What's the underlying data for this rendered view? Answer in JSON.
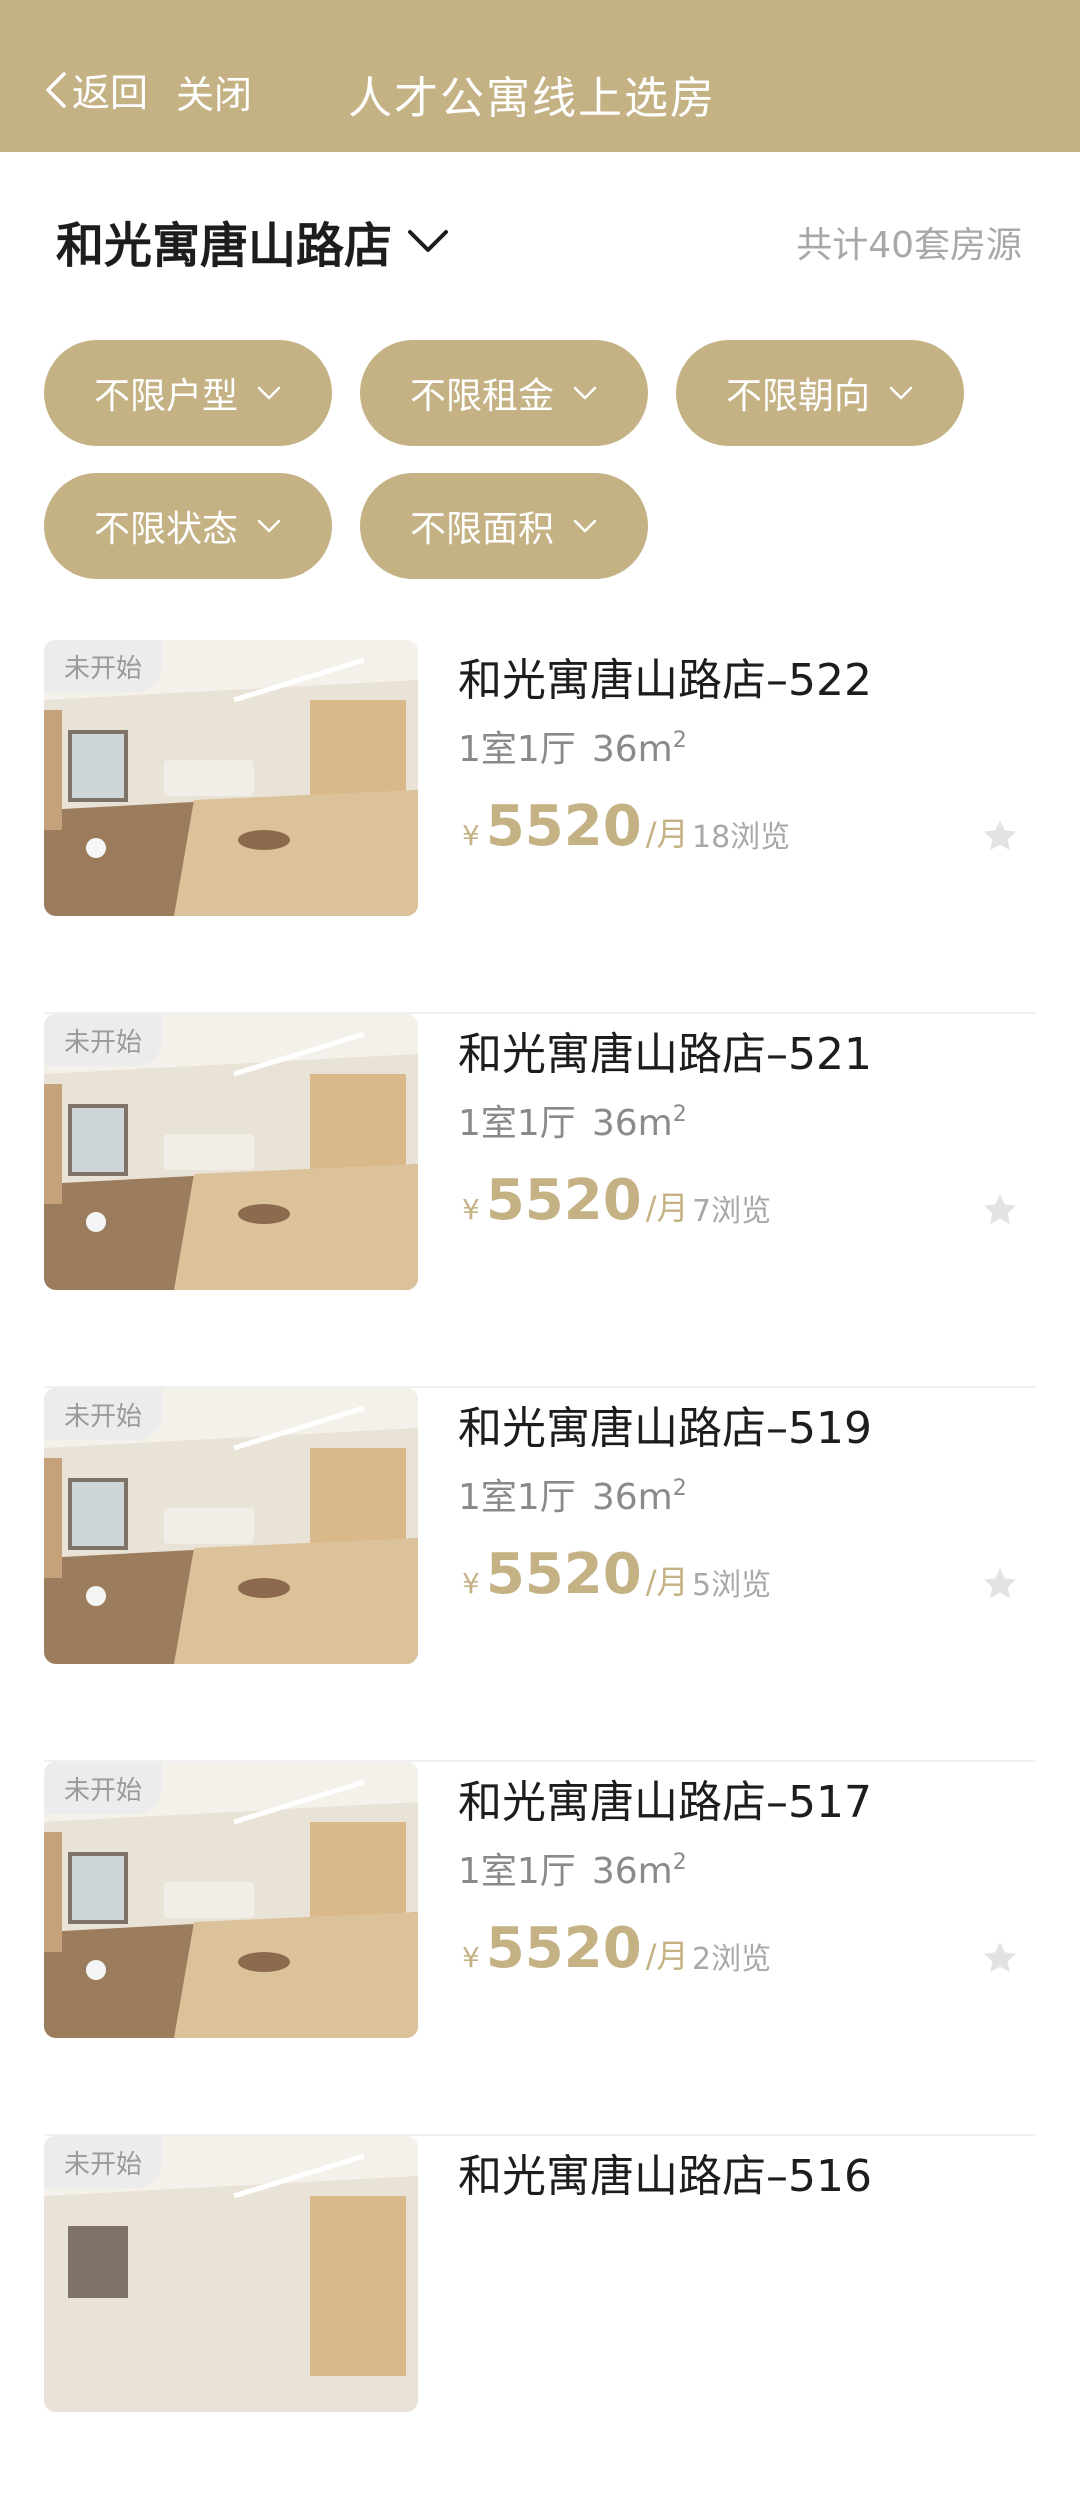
{
  "header": {
    "back_label": "返回",
    "close_label": "关闭",
    "title": "人才公寓线上选房"
  },
  "store": {
    "name": "和光寓唐山路店",
    "total": "共计40套房源"
  },
  "filters": [
    "不限户型",
    "不限租金",
    "不限朝向",
    "不限状态",
    "不限面积"
  ],
  "listings": [
    {
      "status": "未开始",
      "title": "和光寓唐山路店–522",
      "layout": "1室1厅",
      "area": "36m",
      "area_sup": "2",
      "currency": "¥",
      "price": "5520",
      "unit": "/月",
      "views": "18浏览"
    },
    {
      "status": "未开始",
      "title": "和光寓唐山路店–521",
      "layout": "1室1厅",
      "area": "36m",
      "area_sup": "2",
      "currency": "¥",
      "price": "5520",
      "unit": "/月",
      "views": "7浏览"
    },
    {
      "status": "未开始",
      "title": "和光寓唐山路店–519",
      "layout": "1室1厅",
      "area": "36m",
      "area_sup": "2",
      "currency": "¥",
      "price": "5520",
      "unit": "/月",
      "views": "5浏览"
    },
    {
      "status": "未开始",
      "title": "和光寓唐山路店–517",
      "layout": "1室1厅",
      "area": "36m",
      "area_sup": "2",
      "currency": "¥",
      "price": "5520",
      "unit": "/月",
      "views": "2浏览"
    },
    {
      "status": "未开始",
      "title": "和光寓唐山路店–516"
    }
  ],
  "colors": {
    "accent": "#c4b285",
    "text_primary": "#1d1d1d",
    "text_muted": "#a8a8a8"
  },
  "icons": {
    "back": "chevron-left-icon",
    "store_dropdown": "chevron-down-icon",
    "chip_dropdown": "chevron-down-icon",
    "favorite": "star-icon"
  }
}
